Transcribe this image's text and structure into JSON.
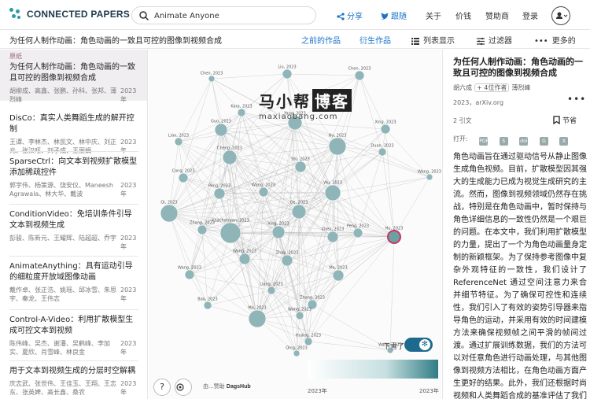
{
  "app": {
    "logo": "CONNECTED PAPERS",
    "search_value": "Animate Anyone",
    "nav": {
      "share": "分享",
      "follow": "跟随",
      "about": "关于",
      "price": "价钱",
      "sponsor": "赞助商",
      "login": "登录"
    }
  },
  "subbar": {
    "graph_title": "为任何人制作动画：角色动画的一致且可控的图像到视频合成",
    "prior": "之前的作品",
    "derivative": "衍生作品",
    "list_view": "列表显示",
    "filter": "过滤器",
    "more": "更多的"
  },
  "papers": [
    {
      "tag": "原纸",
      "title": "为任何人制作动画：角色动画的一致且可控的图像到视频合成",
      "authors": "胡柳成、高鑫、张鹏、孙科、张邦、薄烈峰",
      "year": "2023\n年"
    },
    {
      "title": "DisCo：真实人类舞蹈生成的解开控制",
      "authors": "王谭、李林杰、林凯文、林中庆、刘正元、张汉旺、刘子成、王丽娟",
      "year": "2023\n年"
    },
    {
      "title": "SparseCtrl：向文本到视频扩散模型添加稀疏控件",
      "authors": "郭宇伟、杨策源、饶安仪、Maneesh Agrawala、林大华、戴波",
      "year": "2023\n年"
    },
    {
      "title": "ConditionVideo：免培训条件引导文本到视频生成",
      "authors": "彭骏、陈新元、王耀辉、陆超超、乔宇",
      "year": "2023\n年"
    },
    {
      "title": "AnimateAnything：具有运动引导的细粒度开放域图像动画",
      "authors": "戴作卓、张正浩、姚瑶、邱冰雪、朱思宇、秦龙、王伟志",
      "year": "2023\n年"
    },
    {
      "title": "Control-A-Video：利用扩散模型生成可控文本到视频",
      "authors": "陈伟峰、吴杰、谢潘、吴鹤峰、李加实、夏欣、肖雪峰、林良金",
      "year": "2023\n年"
    },
    {
      "title": "用于文本到视频生成的分层时空解耦",
      "authors": "庆志武、张世伟、王佳玉、王翔、王志东、张英婢、高长鑫、桑农",
      "year": "2023\n年"
    }
  ],
  "graph": {
    "nodes": [
      {
        "label": "Liu, 2023"
      },
      {
        "label": "Chen, 2023"
      },
      {
        "label": "Chen, 2023"
      },
      {
        "label": "Kara, 2023"
      },
      {
        "label": "Guo, 2023"
      },
      {
        "label": "Yang, 2023"
      },
      {
        "label": "Xing, 2023"
      },
      {
        "label": "Liao, 2023"
      },
      {
        "label": "Hu, 2023"
      },
      {
        "label": "Cheng, 2023"
      },
      {
        "label": "Duan, 2023"
      },
      {
        "label": "Shi, 2023"
      },
      {
        "label": "Wang, 2023"
      },
      {
        "label": "Cong, 2023"
      },
      {
        "label": "Peng, 2023"
      },
      {
        "label": "Wu, 2023"
      },
      {
        "label": "Wang, 2023"
      },
      {
        "label": "Qi, 2023"
      },
      {
        "label": "Khachatryan, 2023"
      },
      {
        "label": "Xing, 2023"
      },
      {
        "label": "Ge, 2023"
      },
      {
        "label": "Zhang, 2023"
      },
      {
        "label": "Peng, 2023"
      },
      {
        "label": "Hu, 2023"
      },
      {
        "label": "Chen, 2023"
      },
      {
        "label": "Wang, 2023"
      },
      {
        "label": "Zhao, 2023"
      },
      {
        "label": "Wang, 2023"
      },
      {
        "label": "Liang, 2023"
      },
      {
        "label": "Ma, 2023"
      },
      {
        "label": "Bao, 2023"
      },
      {
        "label": "Zhang, 2023"
      },
      {
        "label": "Wang, 2023"
      },
      {
        "label": "Ma, 2023"
      },
      {
        "label": "Huang, 2023"
      },
      {
        "label": "Qing, 2023"
      },
      {
        "label": "Wang, 2023"
      }
    ],
    "watermark_big": "马小帮",
    "watermark_box": "博客",
    "watermark_url": "maxiaobang.com",
    "sponsor_prefix": "由...赞助",
    "sponsor_name": "DagsHub",
    "snow_label": "下雪了",
    "year_start": "2023年",
    "year_end": "2023年"
  },
  "detail": {
    "title": "为任何人制作动画：角色动画的一致且可控的图像到视频合成",
    "first_author": "胡六成",
    "more_authors": "+ 4位作者",
    "last_author": "薄烈峰",
    "meta": "2023，arXiv.org",
    "citations": "2 引文",
    "bookmark": "节省",
    "open": "打开:",
    "abstract": "角色动画旨在通过驱动信号从静止图像生成角色视频。目前，扩散模型因其强大的生成能力已成为视觉生成研究的主流。然而，图像到视频领域仍然存在挑战，特别是在角色动画中，暂时保持与角色详细信息的一致性仍然是一个艰巨的问题。在本文中，我们利用扩散模型的力量，提出了一个为角色动画量身定制的新颖框架。为了保持参考图像中复杂外观特征的一致性，我们设计了 ReferenceNet 通过空间注意力来合并细节特征。为了确保可控性和连续性，我们引入了有效的姿势引导器来指导角色的运动，并采用有效的时间建模方法来确保视频帧之间平滑的帧间过渡。通过扩展训练数据，我们的方法可以对任意角色进行动画处理，与其他图像到视频方法相比，在角色动画方面产生更好的结果。此外，我们还根据时尚视频和人类舞蹈合成的基准评估了我们的方法，取得了最先进的结果。"
  },
  "colors": {
    "accent": "#1a73c9",
    "node": "#8fb5b9",
    "node_dark": "#6f9ea3",
    "selected_node": "#c03a6a",
    "logo": "#2b9ba5"
  }
}
